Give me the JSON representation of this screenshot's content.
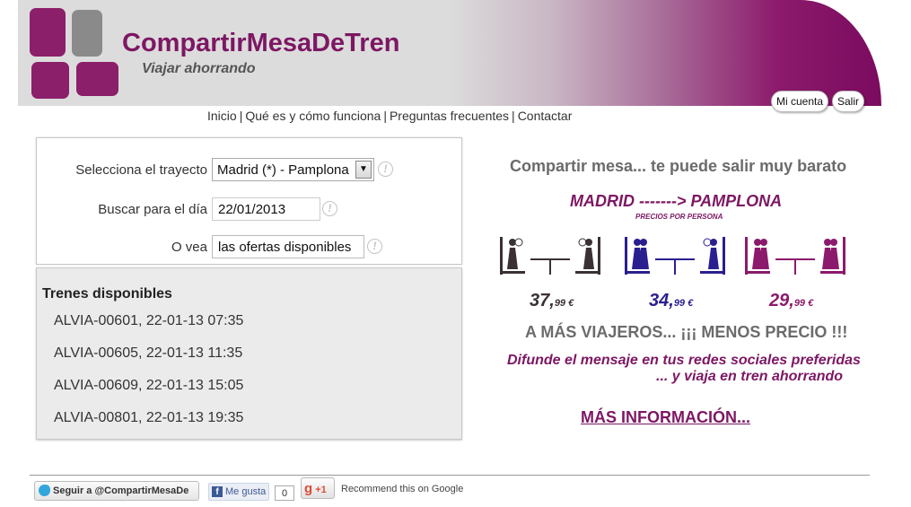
{
  "header": {
    "title": "CompartirMesaDeTren",
    "slogan": "Viajar ahorrando",
    "account_button": "Mi cuenta",
    "logout_button": "Salir"
  },
  "nav": {
    "items": [
      "Inicio",
      "Qué es y cómo funciona",
      "Preguntas frecuentes",
      "Contactar"
    ],
    "separator": "|"
  },
  "form": {
    "route_label": "Selecciona el trayecto",
    "route_value": "Madrid (*) - Pamplona",
    "date_label": "Buscar para el día",
    "date_value": "22/01/2013",
    "offers_label": "O vea",
    "offers_button": "las ofertas disponibles",
    "help_glyph": "!"
  },
  "trains": {
    "title": "Trenes disponibles",
    "items": [
      "ALVIA-00601, 22-01-13 07:35",
      "ALVIA-00605, 22-01-13 11:35",
      "ALVIA-00609, 22-01-13 15:05",
      "ALVIA-00801, 22-01-13 19:35"
    ]
  },
  "promo": {
    "headline": "Compartir mesa... te puede salir muy barato",
    "route": "MADRID -------> PAMPLONA",
    "per_person": "PRECIOS POR PERSONA",
    "prices": [
      {
        "main": "37,",
        "cents": "99 €",
        "color": "#3a3035"
      },
      {
        "main": "34,",
        "cents": "99 €",
        "color": "#2a1f8f"
      },
      {
        "main": "29,",
        "cents": "99 €",
        "color": "#8c1a6c"
      }
    ],
    "slogan": "A MÁS VIAJEROS... ¡¡¡ MENOS PRECIO !!!",
    "spread_line1": "Difunde el mensaje en tus redes sociales preferidas",
    "spread_line2": "... y viaja en tren ahorrando",
    "more_info": "MÁS INFORMACIÓN..."
  },
  "footer": {
    "twitter_button": "Seguir a @CompartirMesaDe",
    "facebook_button": "Me gusta",
    "facebook_count": "0",
    "gplus_g": "g",
    "gplus_label": "+1",
    "recommend_text": "Recommend this on Google"
  },
  "colors": {
    "brand_purple": "#7d1763",
    "gray_text": "#6b6b6b",
    "icon_dark": "#3a3035",
    "icon_blue": "#2a1f8f",
    "icon_purple": "#8c1a6c"
  }
}
